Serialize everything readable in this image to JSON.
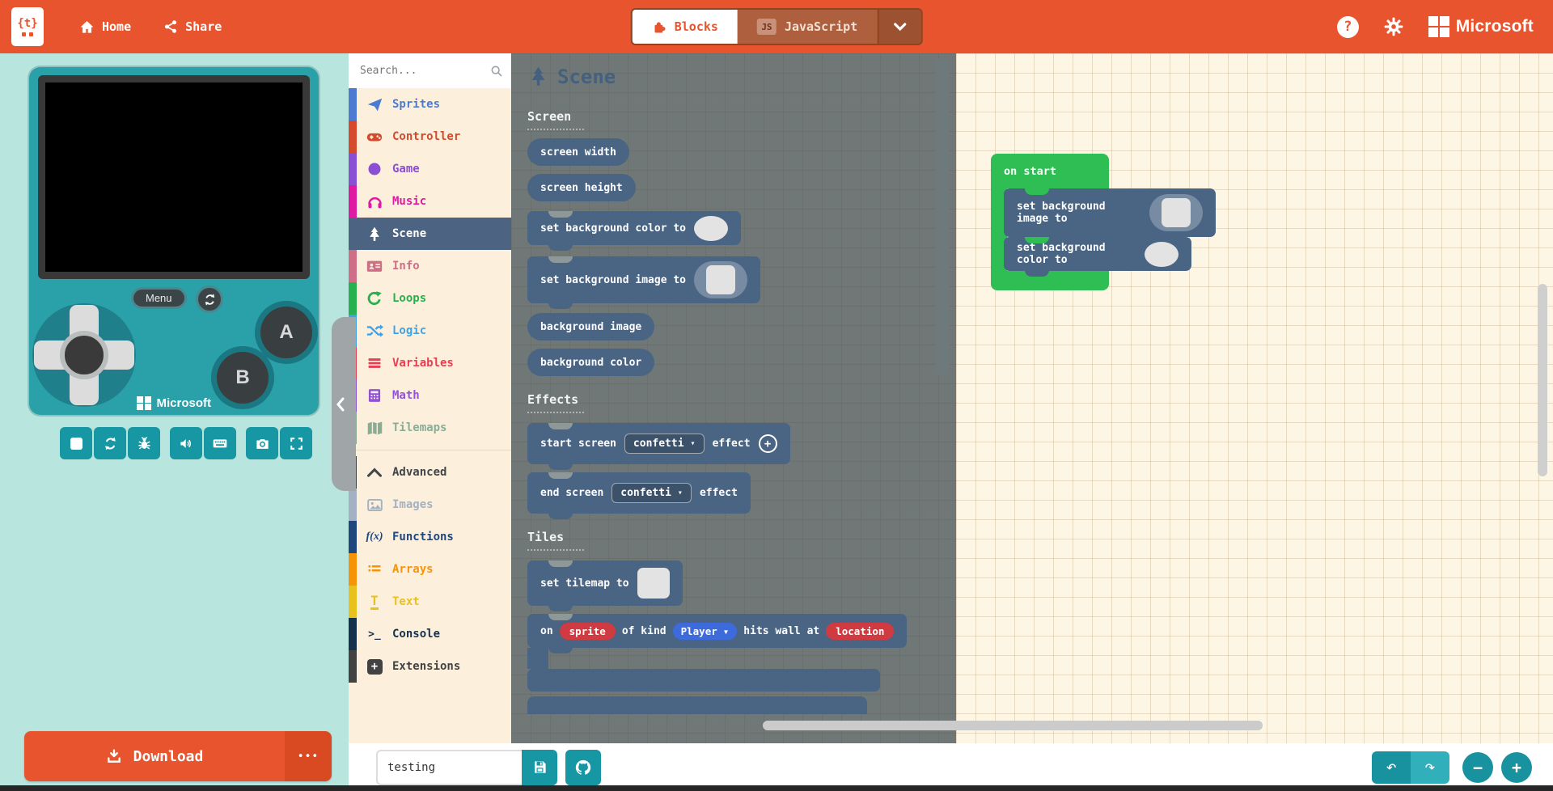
{
  "header": {
    "home": "Home",
    "share": "Share",
    "blocks_tab": "Blocks",
    "javascript_tab": "JavaScript",
    "js_badge": "JS",
    "microsoft": "Microsoft"
  },
  "simulator": {
    "menu": "Menu",
    "a": "A",
    "b": "B",
    "brand": "Microsoft"
  },
  "download": {
    "label": "Download",
    "more": "•••"
  },
  "toolbox": {
    "search_placeholder": "Search...",
    "categories": [
      {
        "label": "Sprites",
        "color": "#4C7BD1"
      },
      {
        "label": "Controller",
        "color": "#D5492C"
      },
      {
        "label": "Game",
        "color": "#8A4FD3"
      },
      {
        "label": "Music",
        "color": "#DF1AA2"
      },
      {
        "label": "Scene",
        "color": "#4C6481"
      },
      {
        "label": "Info",
        "color": "#CF6E87"
      },
      {
        "label": "Loops",
        "color": "#26B04E"
      },
      {
        "label": "Logic",
        "color": "#3FA2E9"
      },
      {
        "label": "Variables",
        "color": "#E83D52"
      },
      {
        "label": "Math",
        "color": "#9152D6"
      },
      {
        "label": "Tilemaps",
        "color": "#87AD97"
      }
    ],
    "advanced": [
      {
        "label": "Advanced",
        "color": "#41454A"
      },
      {
        "label": "Images",
        "color": "#A4B1C2"
      },
      {
        "label": "Functions",
        "color": "#20477D"
      },
      {
        "label": "Arrays",
        "color": "#F79308"
      },
      {
        "label": "Text",
        "color": "#E8C11C"
      },
      {
        "label": "Console",
        "color": "#16314D"
      },
      {
        "label": "Extensions",
        "color": "#424242"
      }
    ]
  },
  "flyout": {
    "title": "Scene",
    "sections": {
      "screen": "Screen",
      "effects": "Effects",
      "tiles": "Tiles"
    },
    "blocks": {
      "screen_width": "screen width",
      "screen_height": "screen height",
      "set_bg_color": "set background color to",
      "set_bg_image": "set background image to",
      "bg_image": "background image",
      "bg_color": "background color",
      "start_screen": "start screen",
      "start_effect_value": "confetti",
      "start_screen_suffix": "effect",
      "end_screen": "end screen",
      "end_effect_value": "confetti",
      "end_screen_suffix": "effect",
      "set_tilemap": "set tilemap to",
      "on": "on",
      "sprite": "sprite",
      "of_kind": "of kind",
      "player": "Player",
      "hits_wall_at": "hits wall at",
      "location": "location"
    }
  },
  "workspace": {
    "on_start": "on start",
    "set_bg_image": "set background image to",
    "set_bg_color": "set background color to"
  },
  "bottombar": {
    "filename": "testing"
  },
  "glyphs": {
    "caret": "▾",
    "undo": "↶",
    "redo": "↷",
    "minus": "−",
    "plus": "+",
    "help": "?",
    "fx": "f(x)",
    "console": ">_",
    "text_T": "T",
    "logo": "{t}"
  },
  "colors": {
    "header": "#E8542D",
    "scene_block": "#4A6483",
    "event_green": "#2EBE54",
    "pill_red": "#D03A41",
    "dropdown_blue": "#3E6BDB",
    "sim_button": "#1697A3"
  }
}
